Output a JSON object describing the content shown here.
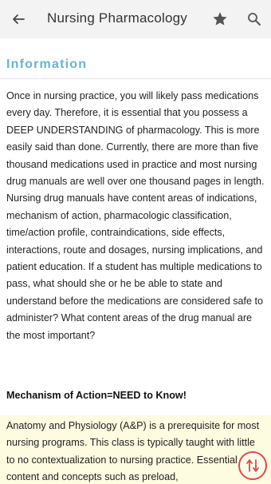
{
  "toolbar": {
    "title": "Nursing Pharmacology",
    "back_icon": "arrow-left-icon",
    "favorite_icon": "star-icon",
    "search_icon": "search-icon"
  },
  "section": {
    "title": "Information",
    "title_color": "#6bb3c9"
  },
  "content": {
    "paragraph": "Once in nursing practice, you will likely pass medications every day. Therefore, it is essential that you possess a DEEP UNDERSTANDING of pharmacology. This is more easily said than done. Currently, there are more than five thousand medications used in practice and most nursing drug manuals are well over one thousand pages in length. Nursing drug manuals have content areas of indications, mechanism of action, pharmacologic classification, time/action profile, contraindications, side effects, interactions, route and dosages, nursing implications, and patient education. If a student has multiple medications to pass, what should she or he be able to state and understand before the medications are considered safe to administer? What content areas of the drug manual are the most important?",
    "subheading": "Mechanism of Action=NEED to Know!",
    "highlighted_paragraph": "Anatomy and Physiology (A&P) is a prerequisite for most nursing programs. This class is typically taught with little to no contextualization to nursing practice. Essential content and concepts such as preload,",
    "highlight_color": "#fdfbe0"
  },
  "fab": {
    "icon": "scroll-arrows-icon",
    "color": "#d94a4a"
  }
}
